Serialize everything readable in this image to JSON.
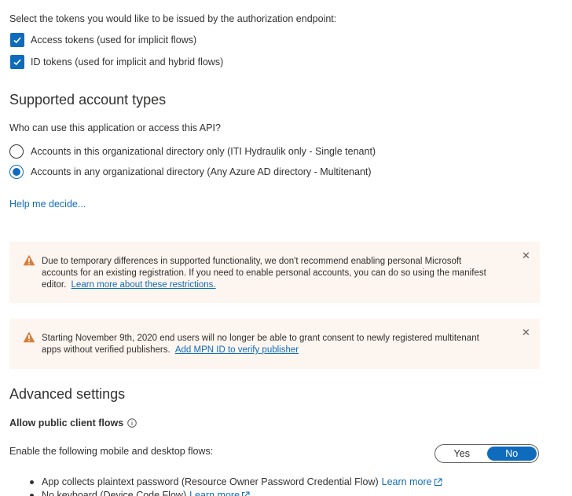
{
  "tokens": {
    "prompt": "Select the tokens you would like to be issued by the authorization endpoint:",
    "items": [
      {
        "label": "Access tokens (used for implicit flows)",
        "checked": true
      },
      {
        "label": "ID tokens (used for implicit and hybrid flows)",
        "checked": true
      }
    ]
  },
  "account_types": {
    "title": "Supported account types",
    "question": "Who can use this application or access this API?",
    "options": [
      {
        "label": "Accounts in this organizational directory only (ITI Hydraulik only - Single tenant)",
        "selected": false
      },
      {
        "label": "Accounts in any organizational directory (Any Azure AD directory - Multitenant)",
        "selected": true
      }
    ],
    "help_link": "Help me decide..."
  },
  "warnings": [
    {
      "line1": "Due to temporary differences in supported functionality, we don't recommend enabling personal Microsoft",
      "line2": "accounts for an existing registration. If you need to enable personal accounts, you can do so using the manifest",
      "line3_prefix": "editor.",
      "link": "Learn more about these restrictions."
    },
    {
      "line1": "Starting November 9th, 2020 end users will no longer be able to grant consent to newly registered multitenant",
      "line2_prefix": "apps without verified publishers.",
      "link": "Add MPN ID to verify publisher"
    }
  ],
  "advanced": {
    "title": "Advanced settings",
    "public_client_label": "Allow public client flows",
    "flows_label": "Enable the following mobile and desktop flows:",
    "toggle": {
      "yes": "Yes",
      "no": "No",
      "selected": "No"
    },
    "bullets": [
      {
        "text": "App collects plaintext password (Resource Owner Password Credential Flow)",
        "link": "Learn more"
      },
      {
        "text": "No keyboard (Device Code Flow)",
        "link": "Learn more"
      }
    ]
  },
  "colors": {
    "accent": "#0f6cbd",
    "warning_bg": "#fdf5ef",
    "warning_icon": "#d67f3c"
  }
}
